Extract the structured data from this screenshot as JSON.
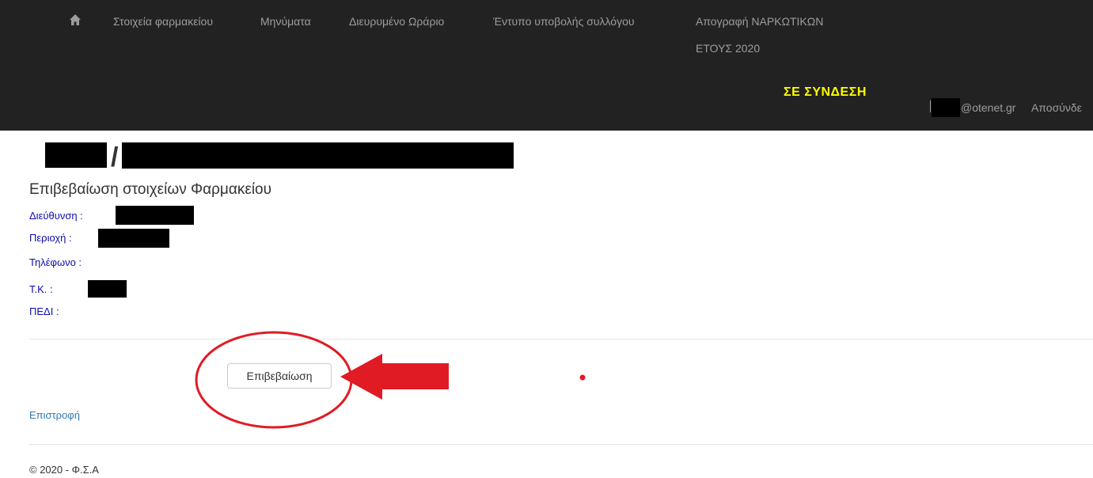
{
  "nav": {
    "items": [
      "Στοιχεία φαρμακείου",
      "Μηνύματα",
      "Διευρυμένο Ωράριο",
      "Έντυπο υποβολής συλλόγου",
      "Απογραφή ΝΑΡΚΩΤΙΚΩΝ"
    ],
    "inventory_line2": "ΕΤΟΥΣ 2020",
    "online_label": "ΣΕ ΣΥΝΔΕΣΗ",
    "user_email": "@otenet.gr",
    "logout_label": "Αποσύνδε"
  },
  "page": {
    "title_separator": "/",
    "subtitle": "Επιβεβαίωση στοιχείων Φαρμακείου",
    "fields": [
      "Διεύθυνση :",
      "Περιοχή :",
      "Τηλέφωνο :",
      "Τ.Κ. :",
      "ΠΕΔΙ :"
    ],
    "confirm_button": "Επιβεβαίωση",
    "back_link": "Επιστροφή"
  },
  "footer": {
    "text": "© 2020 - Φ.Σ.Α"
  },
  "colors": {
    "navbar_bg": "#222222",
    "nav_text": "#9d9d9d",
    "online_text": "#ffff00",
    "field_label": "#0d0db0",
    "link": "#337ab7",
    "annotation_red": "#e01b24"
  }
}
